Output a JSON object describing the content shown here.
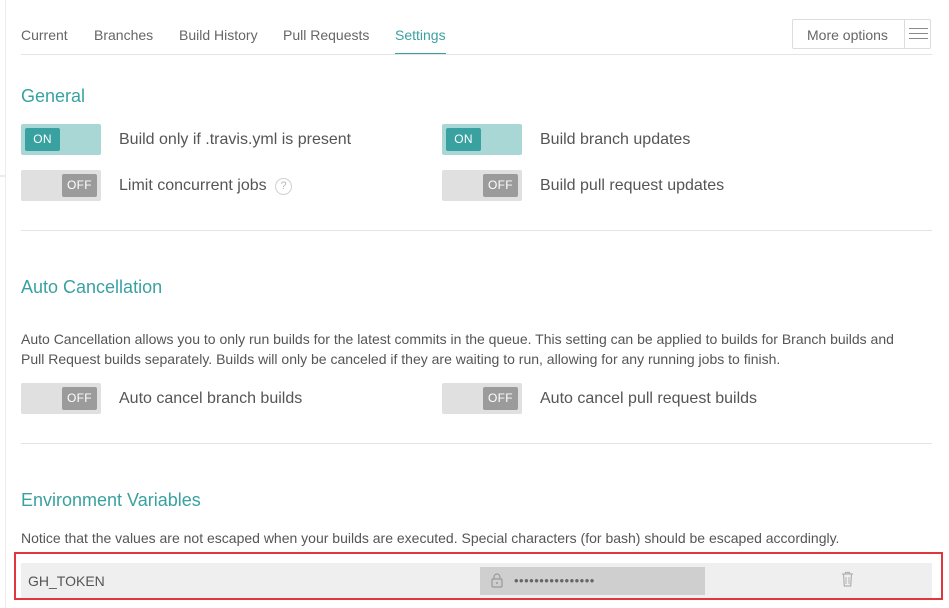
{
  "tabs": {
    "current": "Current",
    "branches": "Branches",
    "build_history": "Build History",
    "pull_requests": "Pull Requests",
    "settings": "Settings",
    "active": "Settings"
  },
  "more_options": {
    "label": "More options",
    "icon": "hamburger-menu-icon"
  },
  "general": {
    "title": "General",
    "build_only_travis_yml": {
      "label": "Build only if .travis.yml is present",
      "state": "ON"
    },
    "build_branch_updates": {
      "label": "Build branch updates",
      "state": "ON"
    },
    "limit_concurrent_jobs": {
      "label": "Limit concurrent jobs",
      "state": "OFF",
      "help": "?"
    },
    "build_pull_request_updates": {
      "label": "Build pull request updates",
      "state": "OFF"
    }
  },
  "auto_cancellation": {
    "title": "Auto Cancellation",
    "description_line1": "Auto Cancellation allows you to only run builds for the latest commits in the queue. This setting can be applied to builds for Branch builds and",
    "description_line2": "Pull Request builds separately. Builds will only be canceled if they are waiting to run, allowing for any running jobs to finish.",
    "branch_builds": {
      "label": "Auto cancel branch builds",
      "state": "OFF"
    },
    "pull_request_builds": {
      "label": "Auto cancel pull request builds",
      "state": "OFF"
    }
  },
  "env_vars": {
    "title": "Environment Variables",
    "notice": "Notice that the values are not escaped when your builds are executed. Special characters (for bash) should be escaped accordingly.",
    "items": [
      {
        "name": "GH_TOKEN",
        "value": "••••••••••••••••"
      }
    ]
  },
  "colors": {
    "accent": "#3aa1a1",
    "toggle_on_track": "#a8d7d6",
    "toggle_off_track": "#e0e0e0",
    "highlight_border": "#e0363c"
  }
}
